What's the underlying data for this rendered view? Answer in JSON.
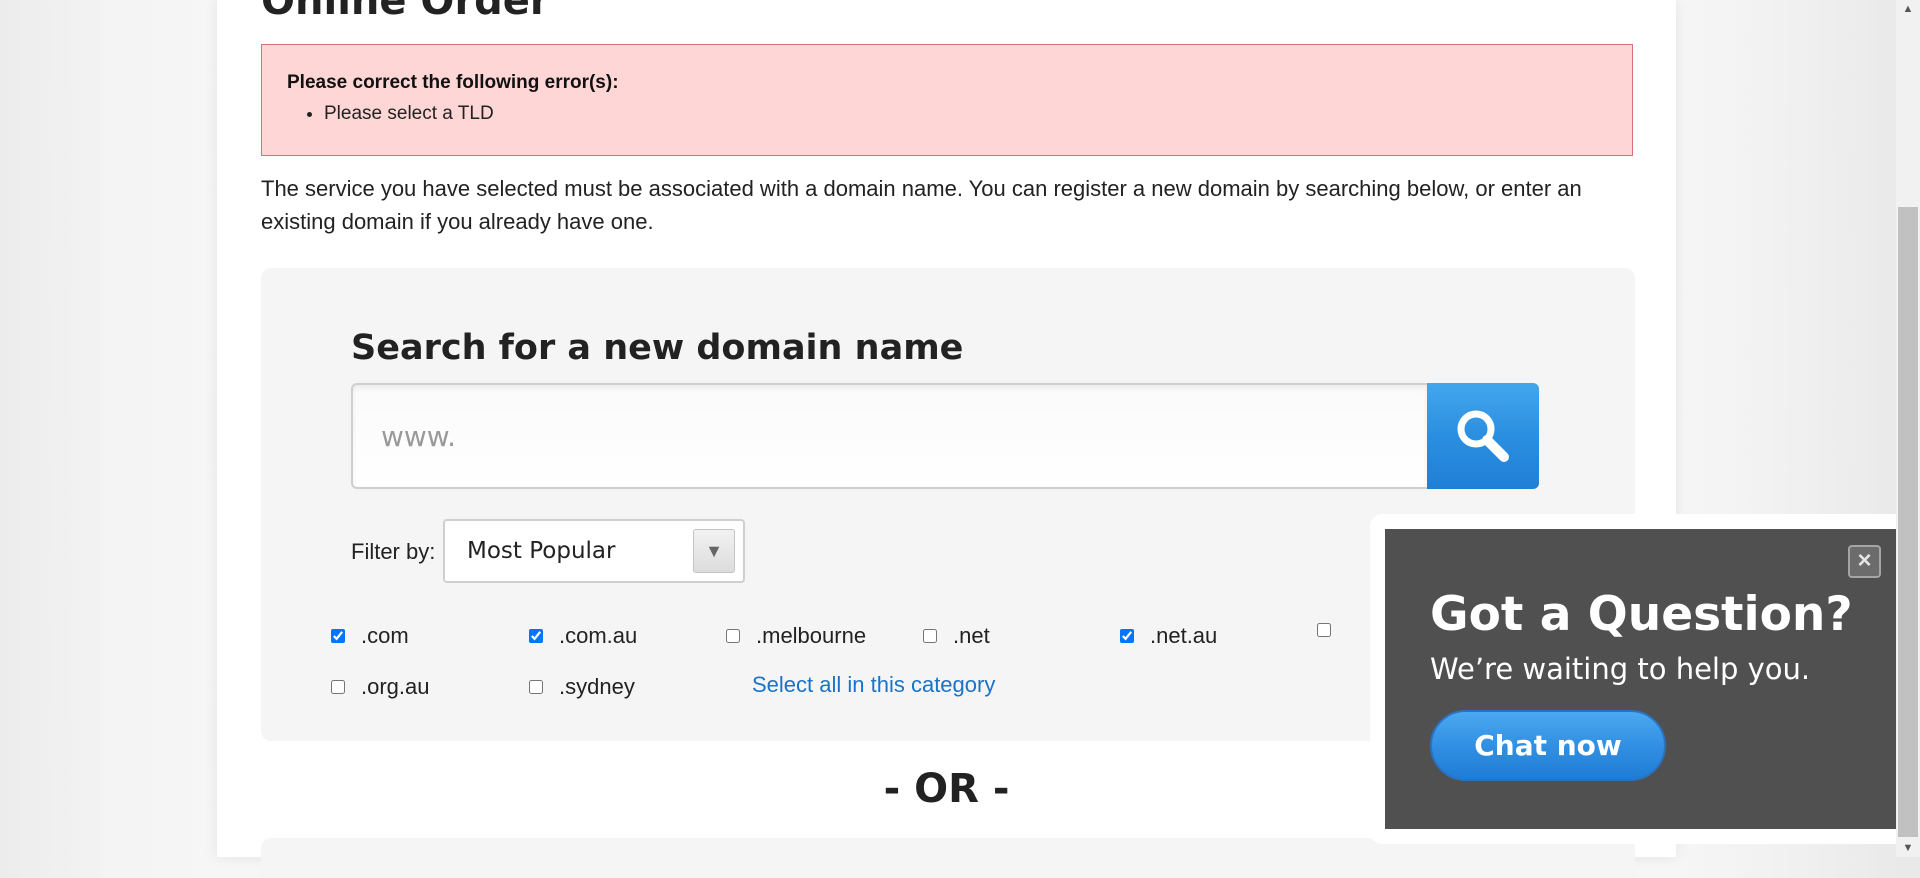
{
  "page": {
    "heading": "Online Order"
  },
  "error": {
    "title": "Please correct the following error(s):",
    "items": [
      "Please select a TLD"
    ]
  },
  "intro_text": "The service you have selected must be associated with a domain name. You can register a new domain by searching below, or enter an existing domain if you already have one.",
  "search": {
    "title": "Search for a new domain name",
    "placeholder": "www.",
    "button_icon": "search-icon"
  },
  "filter": {
    "label": "Filter by:",
    "selected": "Most Popular",
    "arrow_icon": "triangle-down-icon"
  },
  "tlds": [
    {
      "label": ".com",
      "checked": true
    },
    {
      "label": ".com.au",
      "checked": true
    },
    {
      "label": ".melbourne",
      "checked": false
    },
    {
      "label": ".net",
      "checked": false
    },
    {
      "label": ".net.au",
      "checked": true
    },
    {
      "label": "",
      "checked": false
    },
    {
      "label": ".org.au",
      "checked": false
    },
    {
      "label": ".sydney",
      "checked": false
    }
  ],
  "select_all_link": "Select all in this category",
  "or_divider": "- OR -",
  "chat": {
    "title": "Got a Question?",
    "subtitle": "We’re waiting to help you.",
    "button": "Chat now",
    "close_glyph": "×"
  },
  "colors": {
    "error_bg": "#ffd6d6",
    "error_border": "#d9707a",
    "accent_blue": "#2b8fe0",
    "link_blue": "#1a73c8",
    "chat_bg": "#505050"
  }
}
